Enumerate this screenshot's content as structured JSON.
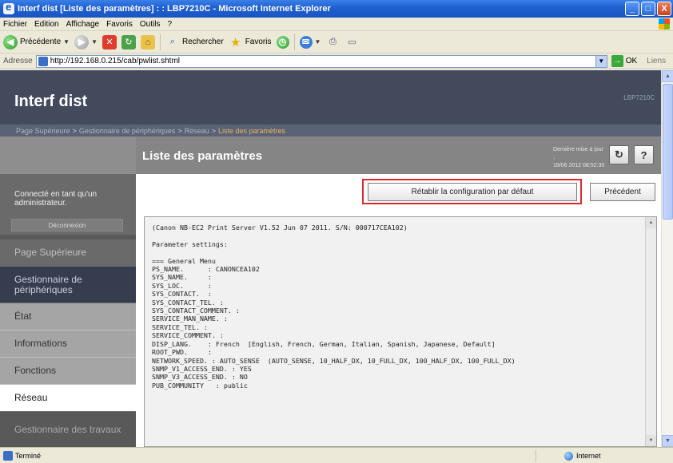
{
  "window": {
    "title": "Interf dist [Liste des paramètres] : : LBP7210C - Microsoft Internet Explorer",
    "minimize": "_",
    "maximize": "□",
    "close": "X"
  },
  "menu": [
    "Fichier",
    "Edition",
    "Affichage",
    "Favoris",
    "Outils",
    "?"
  ],
  "toolbar": {
    "back": "Précédente",
    "search": "Rechercher",
    "favorites": "Favoris"
  },
  "address": {
    "label": "Adresse",
    "url": "http://192.168.0.215/cab/pwlist.shtml",
    "go": "OK",
    "links": "Liens"
  },
  "site": {
    "logo": "Interf dist",
    "printer_id": "LBP7210C",
    "breadcrumb": [
      "Page Supérieure",
      "Gestionnaire de périphériques",
      "Réseau",
      "Liste des paramètres"
    ],
    "page_title": "Liste des paramètres",
    "last_update_label": "Dernière mise à jour :",
    "last_update_value": "18/06 2012 08:52:30",
    "refresh_icon": "↻",
    "help_label": "?"
  },
  "sidebar": {
    "login_text": "Connecté en tant qu'un administrateur.",
    "logout": "Déconnexion",
    "nav": [
      {
        "label": "Page Supérieure",
        "kind": "top"
      },
      {
        "label": "Gestionnaire de périphériques",
        "kind": "section"
      },
      {
        "label": "État",
        "kind": "sub"
      },
      {
        "label": "Informations",
        "kind": "sub"
      },
      {
        "label": "Fonctions",
        "kind": "sub"
      },
      {
        "label": "Réseau",
        "kind": "active"
      },
      {
        "label": "Gestionnaire des travaux",
        "kind": "dim"
      }
    ]
  },
  "main": {
    "restore_button": "Rétablir la configuration par défaut",
    "back_button": "Précédent",
    "log_lines": [
      "(Canon NB-EC2 Print Server V1.52 Jun 07 2011. S/N: 000717CEA102)",
      "",
      "Parameter settings:",
      "",
      "=== General Menu",
      "PS_NAME.      : CANONCEA102",
      "SYS_NAME.     :",
      "SYS_LOC.      :",
      "SYS_CONTACT.  :",
      "SYS_CONTACT_TEL. :",
      "SYS_CONTACT_COMMENT. :",
      "SERVICE_MAN_NAME. :",
      "SERVICE_TEL. :",
      "SERVICE_COMMENT. :",
      "DISP_LANG.    : French  [English, French, German, Italian, Spanish, Japanese, Default]",
      "ROOT_PWD.     :",
      "NETWORK_SPEED. : AUTO_SENSE  (AUTO_SENSE, 10_HALF_DX, 10_FULL_DX, 100_HALF_DX, 100_FULL_DX)",
      "SNMP_V1_ACCESS_END. : YES",
      "SNMP_V3_ACCESS_END. : NO",
      "PUB_COMMUNITY   : public"
    ]
  },
  "status": {
    "left": "Terminé",
    "zone": "Internet"
  }
}
